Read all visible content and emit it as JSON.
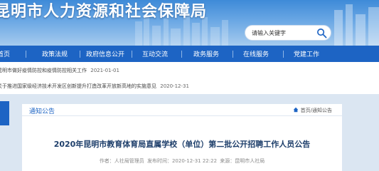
{
  "header": {
    "site_title": "昆明市人力资源和社会保障局",
    "search_placeholder": "请输入关键字"
  },
  "nav": {
    "items": [
      {
        "label": "首页"
      },
      {
        "label": "政策法规"
      },
      {
        "label": "政府信息公开"
      },
      {
        "label": "互动交流"
      },
      {
        "label": "政务服务"
      },
      {
        "label": "在线服务"
      },
      {
        "label": "党建工作"
      }
    ]
  },
  "notices": [
    {
      "text": "昆明市做好疫情防控和疫情防控相关工作",
      "date": "2021-01-01"
    },
    {
      "text": "关于推进国家级经济技术开发区创新提升打造改革开放新高地的实施意见",
      "date": "2020-12-31"
    }
  ],
  "article": {
    "section_title": "通知公告",
    "breadcrumb": "首页/通知公告",
    "title": "2020年昆明市教育体育局直属学校（单位）第二批公开招聘工作人员公告",
    "meta_author": "作者：人社局管理员",
    "meta_time": "发布时间：2020-12-31 22:22",
    "meta_source": "来源：昆明市人社局"
  },
  "colors": {
    "nav_blue": "#1d64c4",
    "title_navy": "#1e3f6b",
    "page_bg": "#dbe6f2"
  },
  "icons": [
    "search-icon",
    "home-icon"
  ]
}
